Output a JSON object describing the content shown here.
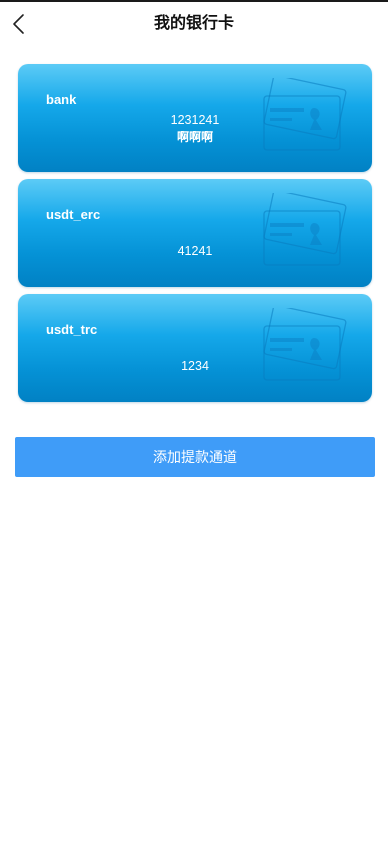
{
  "header": {
    "title": "我的银行卡",
    "back_icon": "chevron-left-icon"
  },
  "cards": [
    {
      "name": "bank",
      "number": "1231241",
      "holder": "啊啊啊"
    },
    {
      "name": "usdt_erc",
      "number": "41241",
      "holder": ""
    },
    {
      "name": "usdt_trc",
      "number": "1234",
      "holder": ""
    }
  ],
  "card_decoration_icon": "bank-card-icon",
  "actions": {
    "add_channel_label": "添加提款通道"
  },
  "colors": {
    "card_gradient_top": "#5ccbf6",
    "card_gradient_bottom": "#0181c4",
    "button_blue": "#3f9cf8",
    "title_text": "#111111"
  }
}
